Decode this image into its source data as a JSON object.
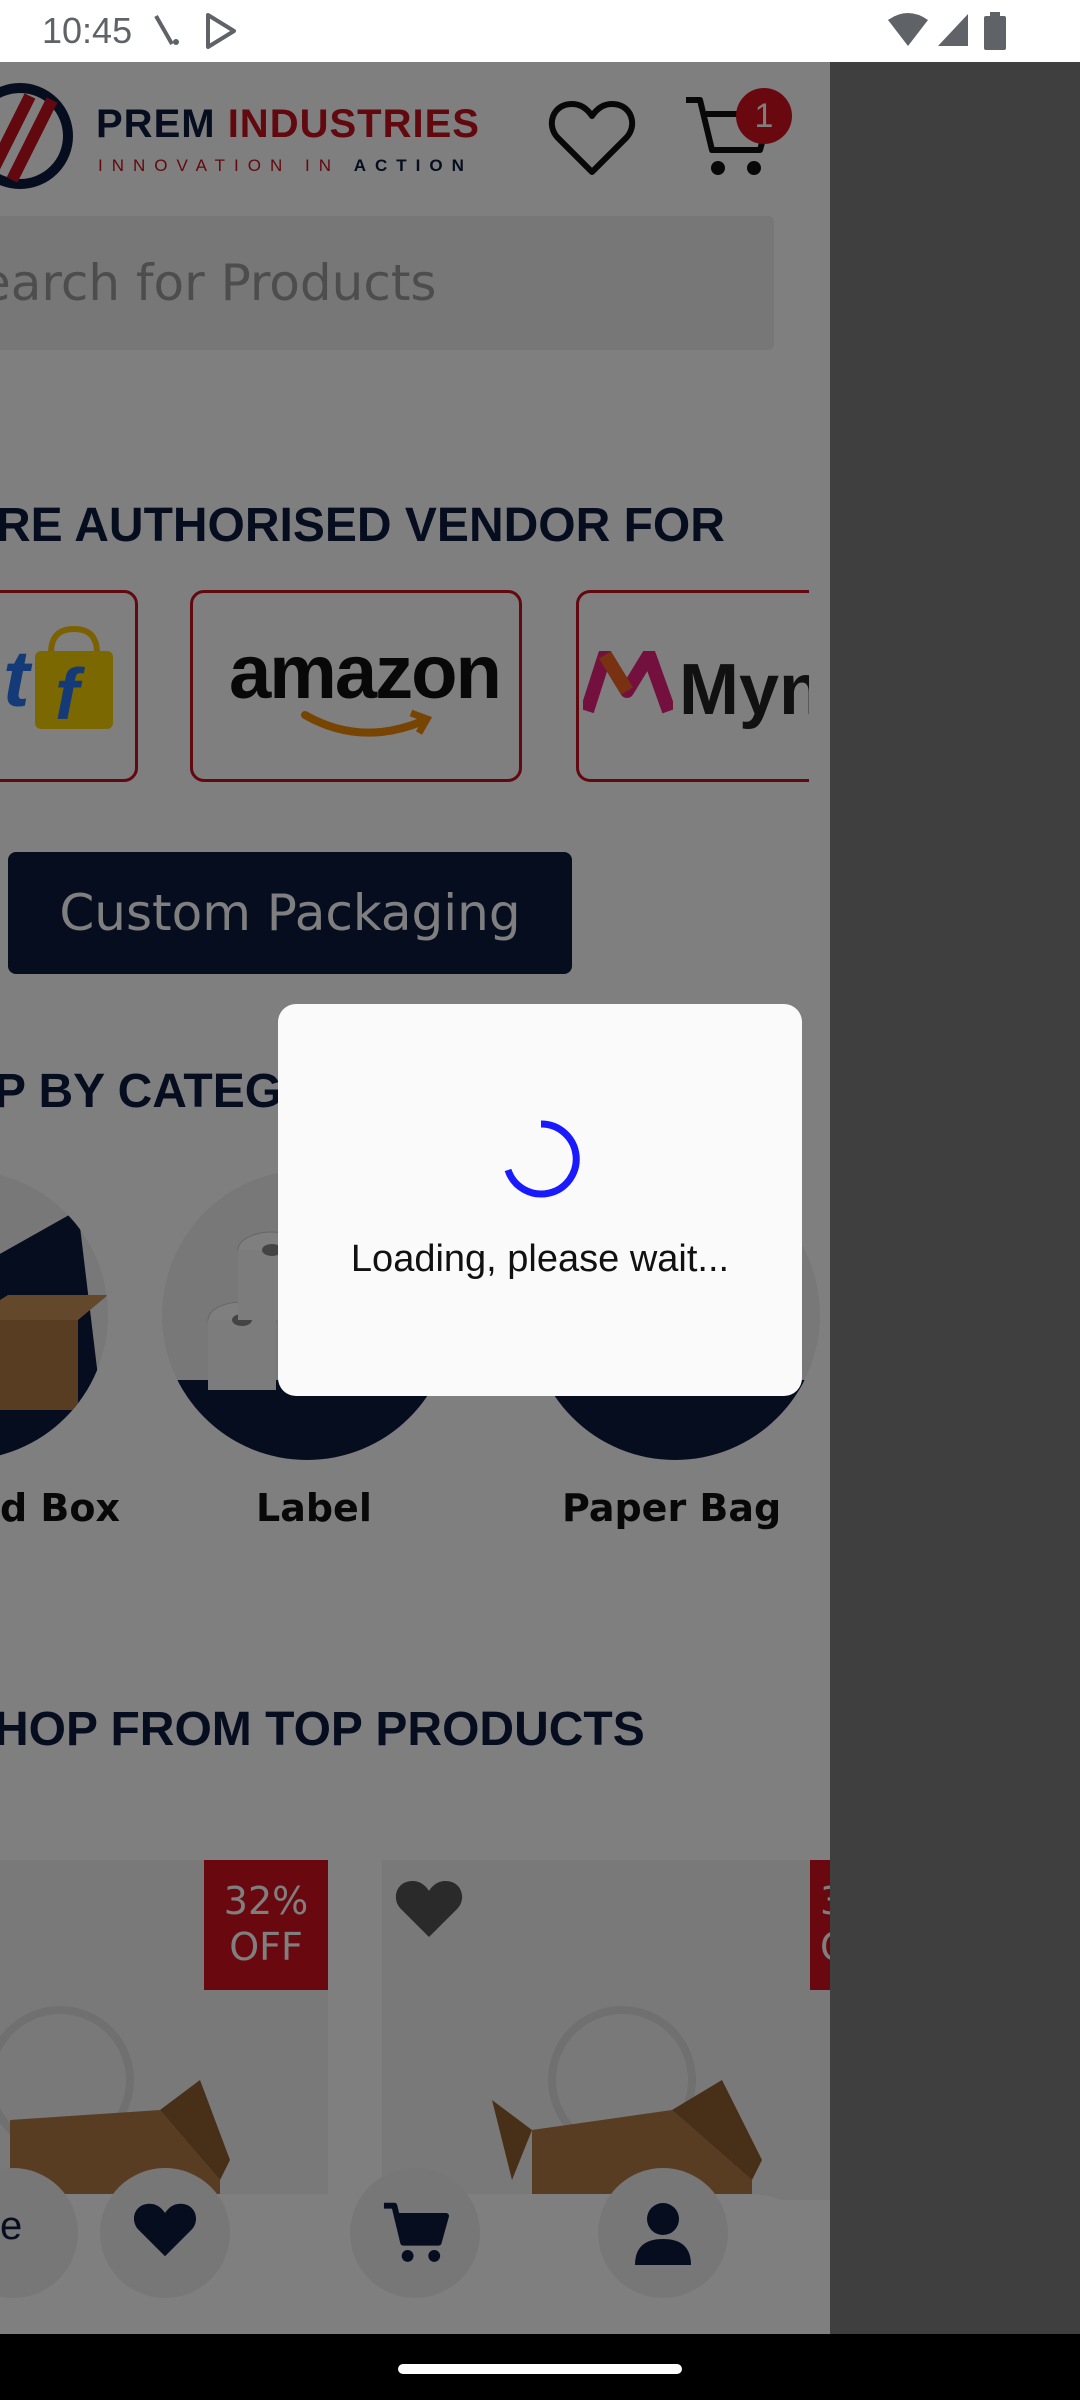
{
  "status_bar": {
    "time": "10:45",
    "icons": [
      "signal-slash-icon",
      "play-store-icon",
      "wifi-icon",
      "cellular-icon",
      "battery-icon"
    ]
  },
  "header": {
    "brand_part1": "PREM ",
    "brand_part2": "INDUSTRIES",
    "tagline_part1": "INNOVATION IN ",
    "tagline_part2": "ACTION",
    "cart_count": "1"
  },
  "search": {
    "placeholder": "earch for Products"
  },
  "vendors": {
    "title": "RE AUTHORISED VENDOR FOR",
    "items": [
      {
        "name": "flipkart-logo",
        "text": "t"
      },
      {
        "name": "amazon-logo",
        "text": "amazon"
      },
      {
        "name": "myntra-logo",
        "text": "Myn"
      }
    ]
  },
  "custom_packaging": {
    "label": "Custom Packaging"
  },
  "categories": {
    "title": "P BY CATEG",
    "items": [
      {
        "label": "d Box"
      },
      {
        "label": "Label"
      },
      {
        "label": "Paper Bag"
      }
    ]
  },
  "top_products": {
    "title": "HOP FROM TOP PRODUCTS",
    "cards": [
      {
        "discount_line1": "32%",
        "discount_line2": "OFF"
      },
      {
        "discount_line1": "3",
        "discount_line2": "O"
      }
    ]
  },
  "bottom_nav": {
    "home_partial": "e",
    "items": [
      "heart-icon",
      "cart-icon",
      "profile-icon"
    ]
  },
  "loading_dialog": {
    "message": "Loading, please wait..."
  },
  "colors": {
    "navy": "#0d1b3e",
    "brand_red": "#c4121f",
    "spinner_blue": "#1a1aff"
  }
}
